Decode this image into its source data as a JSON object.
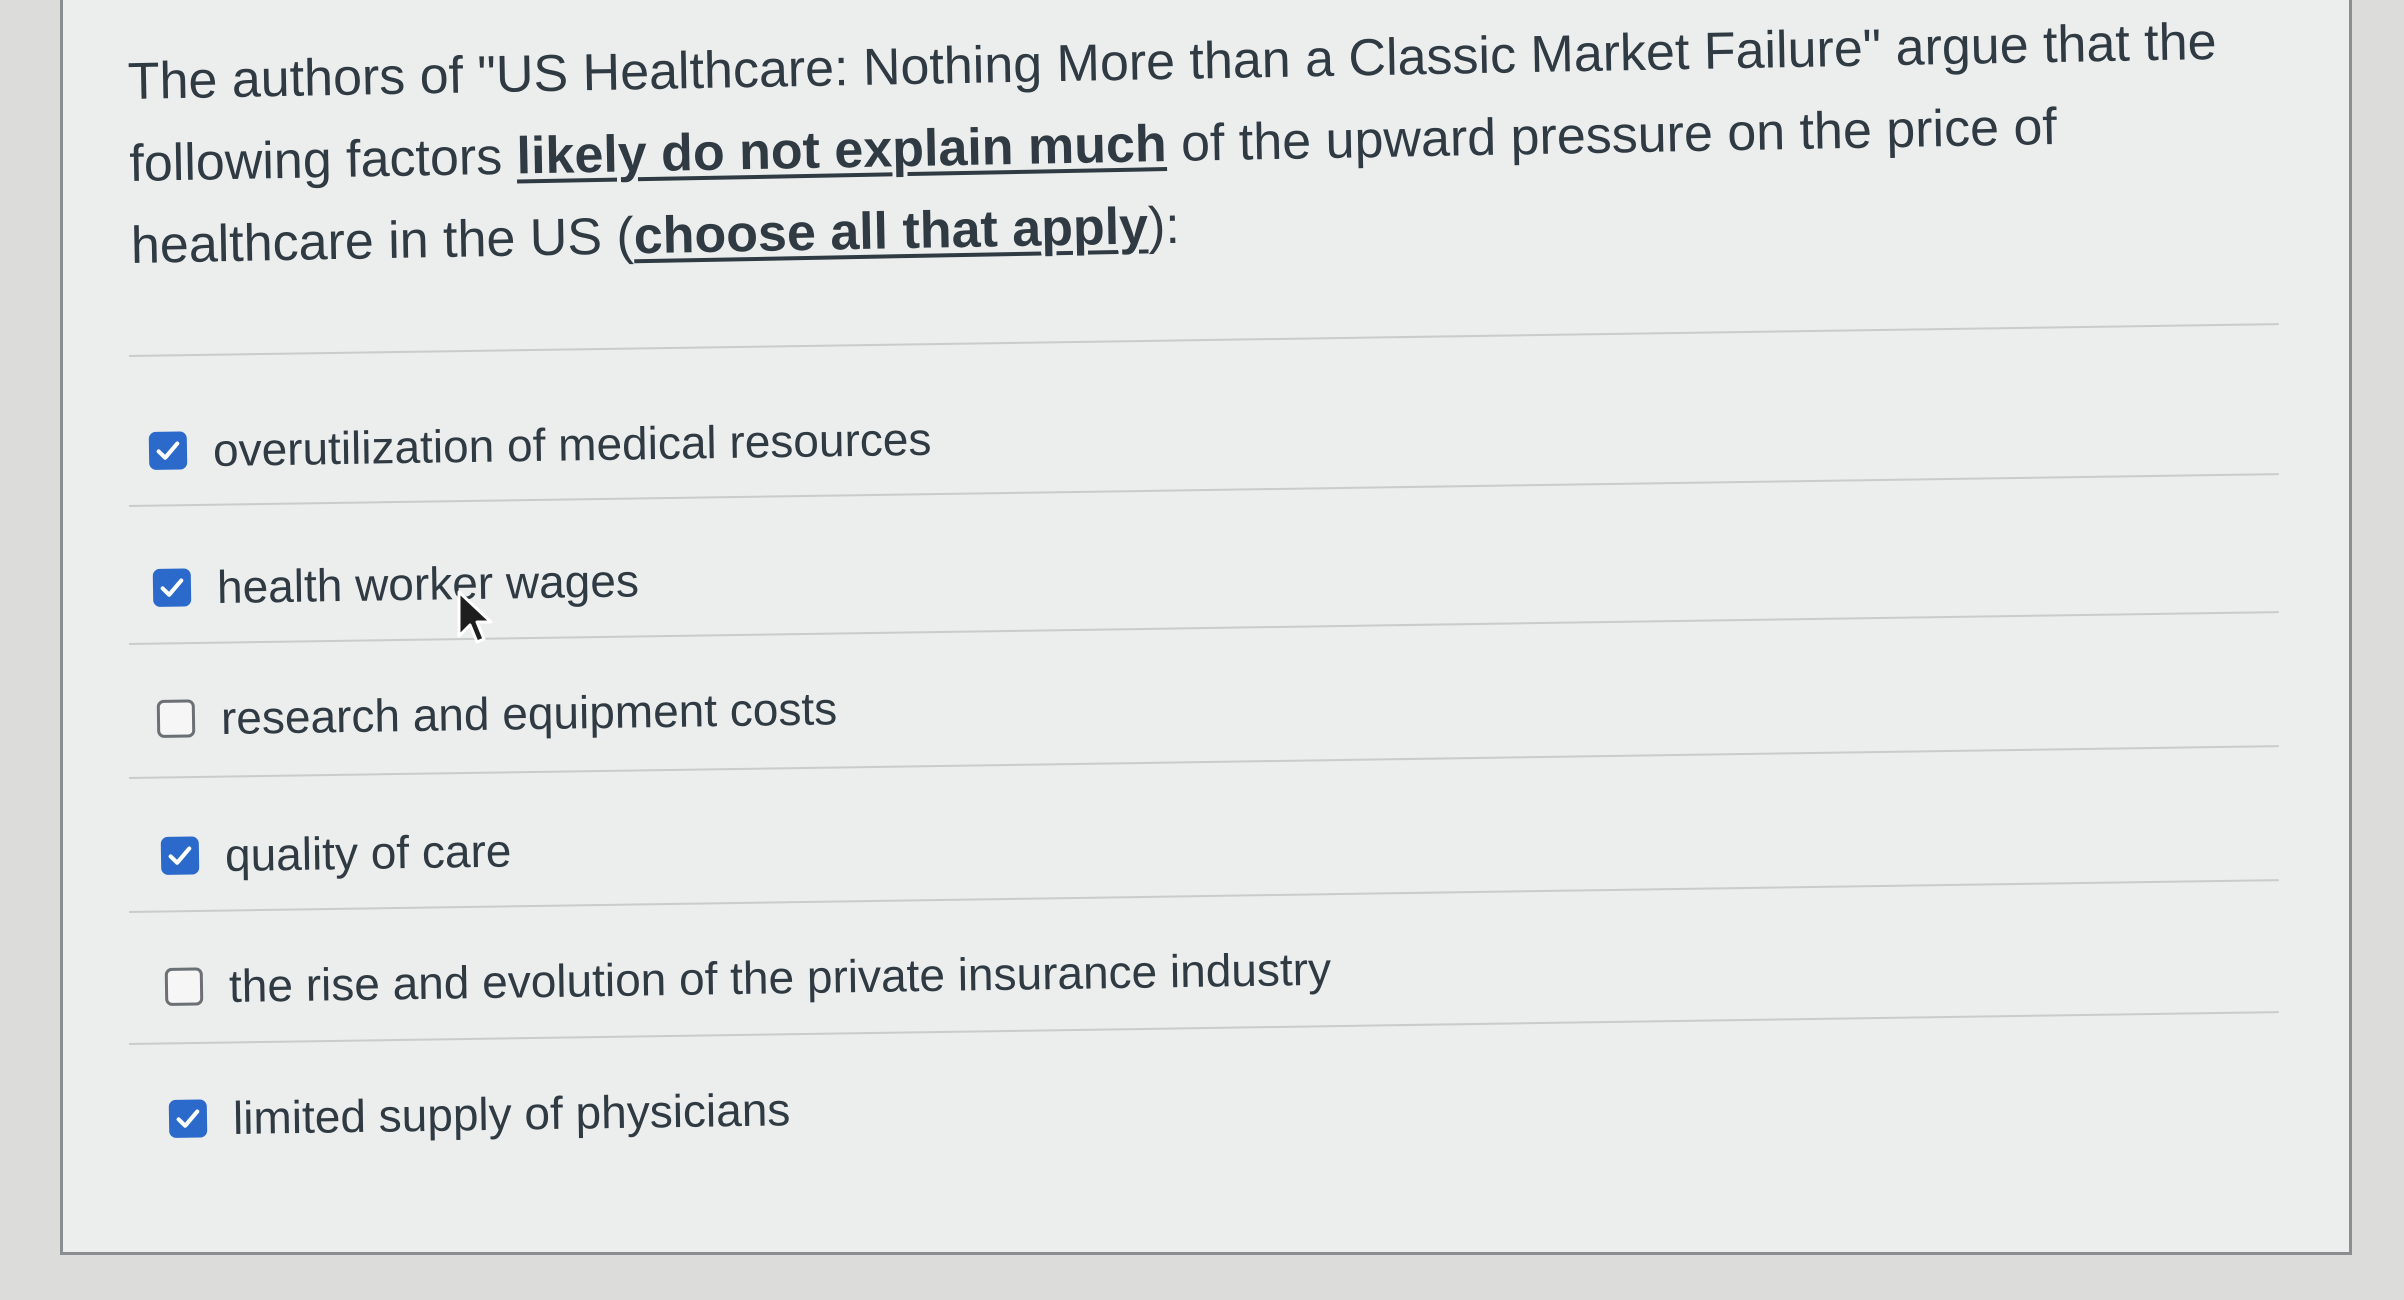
{
  "question": {
    "text_before": "The authors of \"US Healthcare: Nothing More than a Classic Market Failure\" argue that the following factors ",
    "emphasis_1": "likely do not explain much",
    "text_middle": " of the upward pressure on the price of healthcare in the US (",
    "emphasis_2": "choose all that apply",
    "text_after": "):"
  },
  "answers": [
    {
      "label": "overutilization of medical resources",
      "checked": true
    },
    {
      "label": "health worker wages",
      "checked": true
    },
    {
      "label": "research and equipment costs",
      "checked": false
    },
    {
      "label": "quality of care",
      "checked": true
    },
    {
      "label": "the rise and evolution of the private insurance industry",
      "checked": false
    },
    {
      "label": "limited supply of physicians",
      "checked": true
    }
  ],
  "colors": {
    "checkbox_checked": "#2b6acb",
    "checkbox_border": "#6b7075",
    "text": "#2f3a42",
    "card_background": "#eceded"
  },
  "icons": {
    "checked": "checkmark-icon",
    "pointer": "mouse-pointer-icon"
  }
}
